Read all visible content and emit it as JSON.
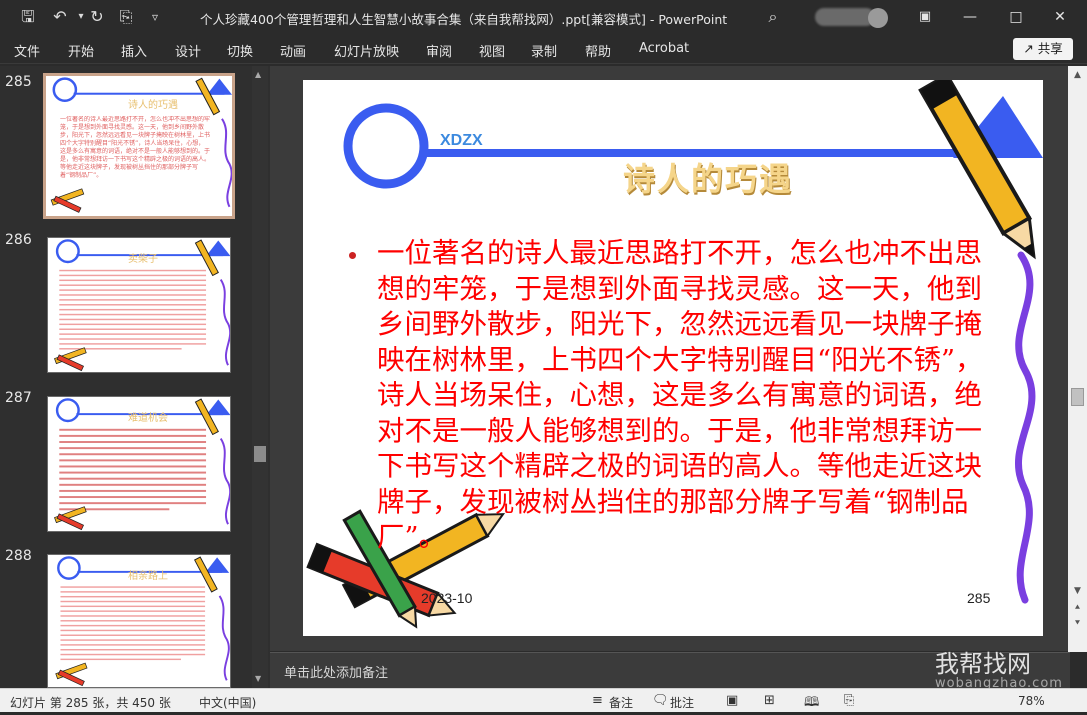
{
  "titlebar": {
    "title": "个人珍藏400个管理哲理和人生智慧小故事合集（来自我帮找网）.ppt[兼容模式]  -  PowerPoint",
    "icons": [
      "save-icon",
      "undo-icon",
      "redo-icon",
      "present-icon",
      "customize-icon",
      "search-icon",
      "ribbon-display-icon",
      "minimize-icon",
      "maximize-icon",
      "close-icon"
    ]
  },
  "menu": {
    "items": [
      "文件",
      "开始",
      "插入",
      "设计",
      "切换",
      "动画",
      "幻灯片放映",
      "审阅",
      "视图",
      "录制",
      "帮助",
      "Acrobat"
    ],
    "share_label": "共享"
  },
  "thumbnails": [
    {
      "number": "285",
      "title": "诗人的巧遇",
      "active": true
    },
    {
      "number": "286",
      "title": "卖柴子",
      "active": false
    },
    {
      "number": "287",
      "title": "难道机会",
      "active": false
    },
    {
      "number": "288",
      "title": "相亲路上",
      "active": false
    }
  ],
  "slide": {
    "logo_text": "XDZX",
    "title": "诗人的巧遇",
    "body": "一位著名的诗人最近思路打不开，怎么也冲不出思想的牢笼，于是想到外面寻找灵感。这一天，他到乡间野外散步，阳光下，忽然远远看见一块牌子掩映在树林里，上书四个大字特别醒目“阳光不锈”，诗人当场呆住，心想，这是多么有寓意的词语，绝对不是一般人能够想到的。于是，他非常想拜访一下书写这个精辟之极的词语的高人。等他走近这块牌子，发现被树丛挡住的那部分牌子写着“钢制品厂”。",
    "date": "2023-10",
    "page_number": "285",
    "colors": {
      "accent_blue": "#3a5cf0",
      "text_red": "#ff0000",
      "title_gold": "#f5d58a",
      "squiggle_purple": "#7a3fe0"
    }
  },
  "notes": {
    "placeholder": "单击此处添加备注"
  },
  "status": {
    "slide_info": "幻灯片 第 285 张，共 450 张",
    "language": "中文(中国)",
    "notes_label": "备注",
    "comments_label": "批注",
    "zoom": "78%"
  },
  "watermark": {
    "text": "我帮找网",
    "sub": "wobangzhao.com"
  }
}
